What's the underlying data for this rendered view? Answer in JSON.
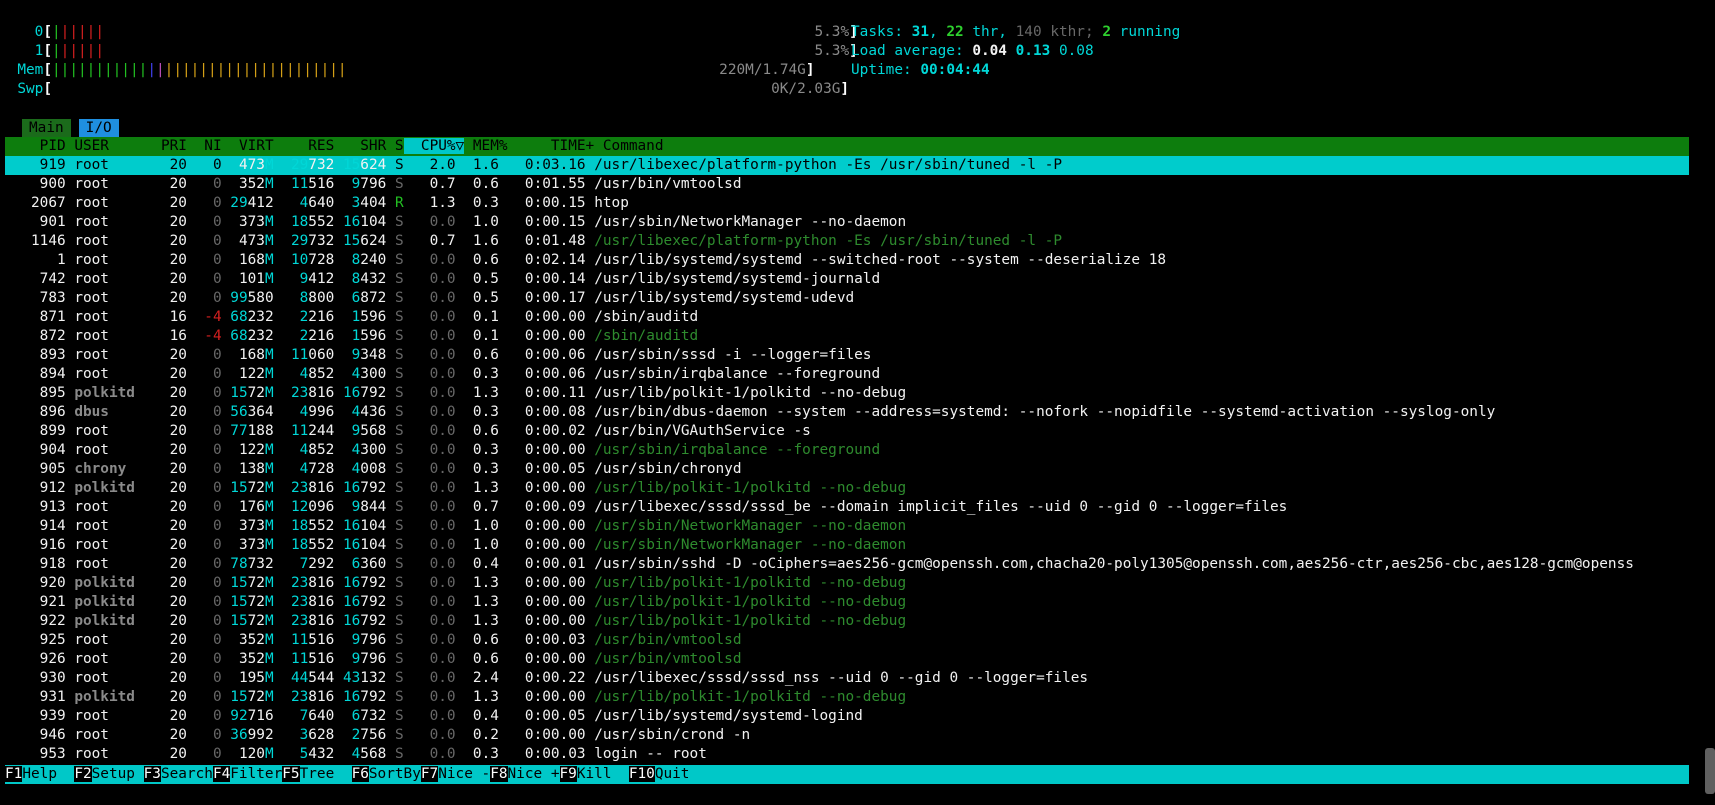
{
  "meters": {
    "cpu0": {
      "label": "0",
      "pct": "5.3%"
    },
    "cpu1": {
      "label": "1",
      "pct": "5.3%"
    },
    "mem": {
      "label": "Mem",
      "text": "220M/1.74G"
    },
    "swp": {
      "label": "Swp",
      "text": "0K/2.03G"
    }
  },
  "stats": {
    "tasks_label": "Tasks:",
    "tasks": "31",
    "threads": "22",
    "thr_label": "thr,",
    "kthreads": "140",
    "kthr_label": "kthr;",
    "running": "2",
    "running_label": "running",
    "load_label": "Load average:",
    "load1": "0.04",
    "load5": "0.13",
    "load15": "0.08",
    "uptime_label": "Uptime:",
    "uptime": "00:04:44"
  },
  "tabs": {
    "main": "Main",
    "io": "I/O"
  },
  "columns": [
    "PID",
    "USER",
    "PRI",
    "NI",
    "VIRT",
    "RES",
    "SHR",
    "S",
    "CPU%▽",
    "MEM%",
    "TIME+",
    "Command"
  ],
  "processes": [
    {
      "pid": "919",
      "user": "root",
      "pri": "20",
      "ni": "0",
      "virt": "473M",
      "res": "29732",
      "shr": "15624",
      "s": "S",
      "cpu": "2.0",
      "mem": "1.6",
      "time": "0:03.16",
      "cmd": "/usr/libexec/platform-python -Es /usr/sbin/tuned -l -P",
      "thread": false,
      "selected": true
    },
    {
      "pid": "900",
      "user": "root",
      "pri": "20",
      "ni": "0",
      "virt": "352M",
      "res": "11516",
      "shr": "9796",
      "s": "S",
      "cpu": "0.7",
      "mem": "0.6",
      "time": "0:01.55",
      "cmd": "/usr/bin/vmtoolsd",
      "thread": false
    },
    {
      "pid": "2067",
      "user": "root",
      "pri": "20",
      "ni": "0",
      "virt": "29412",
      "res": "4640",
      "shr": "3404",
      "s": "R",
      "cpu": "1.3",
      "mem": "0.3",
      "time": "0:00.15",
      "cmd": "htop",
      "thread": false
    },
    {
      "pid": "901",
      "user": "root",
      "pri": "20",
      "ni": "0",
      "virt": "373M",
      "res": "18552",
      "shr": "16104",
      "s": "S",
      "cpu": "0.0",
      "mem": "1.0",
      "time": "0:00.15",
      "cmd": "/usr/sbin/NetworkManager --no-daemon",
      "thread": false
    },
    {
      "pid": "1146",
      "user": "root",
      "pri": "20",
      "ni": "0",
      "virt": "473M",
      "res": "29732",
      "shr": "15624",
      "s": "S",
      "cpu": "0.7",
      "mem": "1.6",
      "time": "0:01.48",
      "cmd": "/usr/libexec/platform-python -Es /usr/sbin/tuned -l -P",
      "thread": true
    },
    {
      "pid": "1",
      "user": "root",
      "pri": "20",
      "ni": "0",
      "virt": "168M",
      "res": "10728",
      "shr": "8240",
      "s": "S",
      "cpu": "0.0",
      "mem": "0.6",
      "time": "0:02.14",
      "cmd": "/usr/lib/systemd/systemd --switched-root --system --deserialize 18",
      "thread": false
    },
    {
      "pid": "742",
      "user": "root",
      "pri": "20",
      "ni": "0",
      "virt": "101M",
      "res": "9412",
      "shr": "8432",
      "s": "S",
      "cpu": "0.0",
      "mem": "0.5",
      "time": "0:00.14",
      "cmd": "/usr/lib/systemd/systemd-journald",
      "thread": false
    },
    {
      "pid": "783",
      "user": "root",
      "pri": "20",
      "ni": "0",
      "virt": "99580",
      "res": "8800",
      "shr": "6872",
      "s": "S",
      "cpu": "0.0",
      "mem": "0.5",
      "time": "0:00.17",
      "cmd": "/usr/lib/systemd/systemd-udevd",
      "thread": false
    },
    {
      "pid": "871",
      "user": "root",
      "pri": "16",
      "ni": "-4",
      "virt": "68232",
      "res": "2216",
      "shr": "1596",
      "s": "S",
      "cpu": "0.0",
      "mem": "0.1",
      "time": "0:00.00",
      "cmd": "/sbin/auditd",
      "thread": false
    },
    {
      "pid": "872",
      "user": "root",
      "pri": "16",
      "ni": "-4",
      "virt": "68232",
      "res": "2216",
      "shr": "1596",
      "s": "S",
      "cpu": "0.0",
      "mem": "0.1",
      "time": "0:00.00",
      "cmd": "/sbin/auditd",
      "thread": true
    },
    {
      "pid": "893",
      "user": "root",
      "pri": "20",
      "ni": "0",
      "virt": "168M",
      "res": "11060",
      "shr": "9348",
      "s": "S",
      "cpu": "0.0",
      "mem": "0.6",
      "time": "0:00.06",
      "cmd": "/usr/sbin/sssd -i --logger=files",
      "thread": false
    },
    {
      "pid": "894",
      "user": "root",
      "pri": "20",
      "ni": "0",
      "virt": "122M",
      "res": "4852",
      "shr": "4300",
      "s": "S",
      "cpu": "0.0",
      "mem": "0.3",
      "time": "0:00.06",
      "cmd": "/usr/sbin/irqbalance --foreground",
      "thread": false
    },
    {
      "pid": "895",
      "user": "polkitd",
      "pri": "20",
      "ni": "0",
      "virt": "1572M",
      "res": "23816",
      "shr": "16792",
      "s": "S",
      "cpu": "0.0",
      "mem": "1.3",
      "time": "0:00.11",
      "cmd": "/usr/lib/polkit-1/polkitd --no-debug",
      "thread": false
    },
    {
      "pid": "896",
      "user": "dbus",
      "pri": "20",
      "ni": "0",
      "virt": "56364",
      "res": "4996",
      "shr": "4436",
      "s": "S",
      "cpu": "0.0",
      "mem": "0.3",
      "time": "0:00.08",
      "cmd": "/usr/bin/dbus-daemon --system --address=systemd: --nofork --nopidfile --systemd-activation --syslog-only",
      "thread": false
    },
    {
      "pid": "899",
      "user": "root",
      "pri": "20",
      "ni": "0",
      "virt": "77188",
      "res": "11244",
      "shr": "9568",
      "s": "S",
      "cpu": "0.0",
      "mem": "0.6",
      "time": "0:00.02",
      "cmd": "/usr/bin/VGAuthService -s",
      "thread": false
    },
    {
      "pid": "904",
      "user": "root",
      "pri": "20",
      "ni": "0",
      "virt": "122M",
      "res": "4852",
      "shr": "4300",
      "s": "S",
      "cpu": "0.0",
      "mem": "0.3",
      "time": "0:00.00",
      "cmd": "/usr/sbin/irqbalance --foreground",
      "thread": true
    },
    {
      "pid": "905",
      "user": "chrony",
      "pri": "20",
      "ni": "0",
      "virt": "138M",
      "res": "4728",
      "shr": "4008",
      "s": "S",
      "cpu": "0.0",
      "mem": "0.3",
      "time": "0:00.05",
      "cmd": "/usr/sbin/chronyd",
      "thread": false
    },
    {
      "pid": "912",
      "user": "polkitd",
      "pri": "20",
      "ni": "0",
      "virt": "1572M",
      "res": "23816",
      "shr": "16792",
      "s": "S",
      "cpu": "0.0",
      "mem": "1.3",
      "time": "0:00.00",
      "cmd": "/usr/lib/polkit-1/polkitd --no-debug",
      "thread": true
    },
    {
      "pid": "913",
      "user": "root",
      "pri": "20",
      "ni": "0",
      "virt": "176M",
      "res": "12096",
      "shr": "9844",
      "s": "S",
      "cpu": "0.0",
      "mem": "0.7",
      "time": "0:00.09",
      "cmd": "/usr/libexec/sssd/sssd_be --domain implicit_files --uid 0 --gid 0 --logger=files",
      "thread": false
    },
    {
      "pid": "914",
      "user": "root",
      "pri": "20",
      "ni": "0",
      "virt": "373M",
      "res": "18552",
      "shr": "16104",
      "s": "S",
      "cpu": "0.0",
      "mem": "1.0",
      "time": "0:00.00",
      "cmd": "/usr/sbin/NetworkManager --no-daemon",
      "thread": true
    },
    {
      "pid": "916",
      "user": "root",
      "pri": "20",
      "ni": "0",
      "virt": "373M",
      "res": "18552",
      "shr": "16104",
      "s": "S",
      "cpu": "0.0",
      "mem": "1.0",
      "time": "0:00.00",
      "cmd": "/usr/sbin/NetworkManager --no-daemon",
      "thread": true
    },
    {
      "pid": "918",
      "user": "root",
      "pri": "20",
      "ni": "0",
      "virt": "78732",
      "res": "7292",
      "shr": "6360",
      "s": "S",
      "cpu": "0.0",
      "mem": "0.4",
      "time": "0:00.01",
      "cmd": "/usr/sbin/sshd -D -oCiphers=aes256-gcm@openssh.com,chacha20-poly1305@openssh.com,aes256-ctr,aes256-cbc,aes128-gcm@openss",
      "thread": false
    },
    {
      "pid": "920",
      "user": "polkitd",
      "pri": "20",
      "ni": "0",
      "virt": "1572M",
      "res": "23816",
      "shr": "16792",
      "s": "S",
      "cpu": "0.0",
      "mem": "1.3",
      "time": "0:00.00",
      "cmd": "/usr/lib/polkit-1/polkitd --no-debug",
      "thread": true
    },
    {
      "pid": "921",
      "user": "polkitd",
      "pri": "20",
      "ni": "0",
      "virt": "1572M",
      "res": "23816",
      "shr": "16792",
      "s": "S",
      "cpu": "0.0",
      "mem": "1.3",
      "time": "0:00.00",
      "cmd": "/usr/lib/polkit-1/polkitd --no-debug",
      "thread": true
    },
    {
      "pid": "922",
      "user": "polkitd",
      "pri": "20",
      "ni": "0",
      "virt": "1572M",
      "res": "23816",
      "shr": "16792",
      "s": "S",
      "cpu": "0.0",
      "mem": "1.3",
      "time": "0:00.00",
      "cmd": "/usr/lib/polkit-1/polkitd --no-debug",
      "thread": true
    },
    {
      "pid": "925",
      "user": "root",
      "pri": "20",
      "ni": "0",
      "virt": "352M",
      "res": "11516",
      "shr": "9796",
      "s": "S",
      "cpu": "0.0",
      "mem": "0.6",
      "time": "0:00.03",
      "cmd": "/usr/bin/vmtoolsd",
      "thread": true
    },
    {
      "pid": "926",
      "user": "root",
      "pri": "20",
      "ni": "0",
      "virt": "352M",
      "res": "11516",
      "shr": "9796",
      "s": "S",
      "cpu": "0.0",
      "mem": "0.6",
      "time": "0:00.00",
      "cmd": "/usr/bin/vmtoolsd",
      "thread": true
    },
    {
      "pid": "930",
      "user": "root",
      "pri": "20",
      "ni": "0",
      "virt": "195M",
      "res": "44544",
      "shr": "43132",
      "s": "S",
      "cpu": "0.0",
      "mem": "2.4",
      "time": "0:00.22",
      "cmd": "/usr/libexec/sssd/sssd_nss --uid 0 --gid 0 --logger=files",
      "thread": false
    },
    {
      "pid": "931",
      "user": "polkitd",
      "pri": "20",
      "ni": "0",
      "virt": "1572M",
      "res": "23816",
      "shr": "16792",
      "s": "S",
      "cpu": "0.0",
      "mem": "1.3",
      "time": "0:00.00",
      "cmd": "/usr/lib/polkit-1/polkitd --no-debug",
      "thread": true
    },
    {
      "pid": "939",
      "user": "root",
      "pri": "20",
      "ni": "0",
      "virt": "92716",
      "res": "7640",
      "shr": "6732",
      "s": "S",
      "cpu": "0.0",
      "mem": "0.4",
      "time": "0:00.05",
      "cmd": "/usr/lib/systemd/systemd-logind",
      "thread": false
    },
    {
      "pid": "946",
      "user": "root",
      "pri": "20",
      "ni": "0",
      "virt": "36992",
      "res": "3628",
      "shr": "2756",
      "s": "S",
      "cpu": "0.0",
      "mem": "0.2",
      "time": "0:00.00",
      "cmd": "/usr/sbin/crond -n",
      "thread": false
    },
    {
      "pid": "953",
      "user": "root",
      "pri": "20",
      "ni": "0",
      "virt": "120M",
      "res": "5432",
      "shr": "4568",
      "s": "S",
      "cpu": "0.0",
      "mem": "0.3",
      "time": "0:00.03",
      "cmd": "login -- root",
      "thread": false
    }
  ],
  "fkeys": [
    {
      "key": "F1",
      "label": "Help  "
    },
    {
      "key": "F2",
      "label": "Setup "
    },
    {
      "key": "F3",
      "label": "Search"
    },
    {
      "key": "F4",
      "label": "Filter"
    },
    {
      "key": "F5",
      "label": "Tree  "
    },
    {
      "key": "F6",
      "label": "SortBy"
    },
    {
      "key": "F7",
      "label": "Nice -"
    },
    {
      "key": "F8",
      "label": "Nice +"
    },
    {
      "key": "F9",
      "label": "Kill  "
    },
    {
      "key": "F10",
      "label": "Quit  "
    }
  ]
}
